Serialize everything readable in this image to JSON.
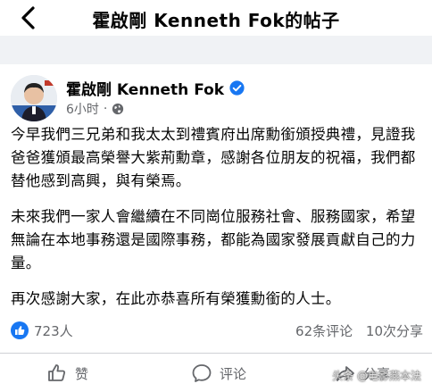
{
  "header": {
    "back_icon": "back-chevron-icon",
    "title": "霍啟剛 Kenneth Fok的帖子"
  },
  "post": {
    "author": "霍啟剛 Kenneth Fok",
    "verified_icon": "verified-badge-icon",
    "time": "6小时",
    "separator": "·",
    "privacy_icon": "globe-icon",
    "paragraphs": [
      "今早我們三兄弟和我太太到禮賓府出席勳銜頒授典禮，見證我爸爸獲頒最高榮譽大紫荊勳章，感謝各位朋友的祝福，我們都替他感到高興，與有榮焉。",
      "未來我們一家人會繼續在不同崗位服務社會、服務國家，希望無論在本地事務還是國際事務，都能為國家發展貢獻自己的力量。",
      "再次感謝大家，在此亦恭喜所有榮獲勳銜的人士。"
    ]
  },
  "stats": {
    "like_icon": "thumbs-up-badge-icon",
    "likes": "723人",
    "comments": "62条评论",
    "shares": "10次分享"
  },
  "actions": {
    "like_label": "赞",
    "comment_label": "评论",
    "share_label": "分享"
  },
  "watermark": "头条 @电影燕本法",
  "colors": {
    "like_blue": "#1877f2",
    "secondary_text": "#65676b",
    "divider_bg": "#f0f2f5"
  }
}
